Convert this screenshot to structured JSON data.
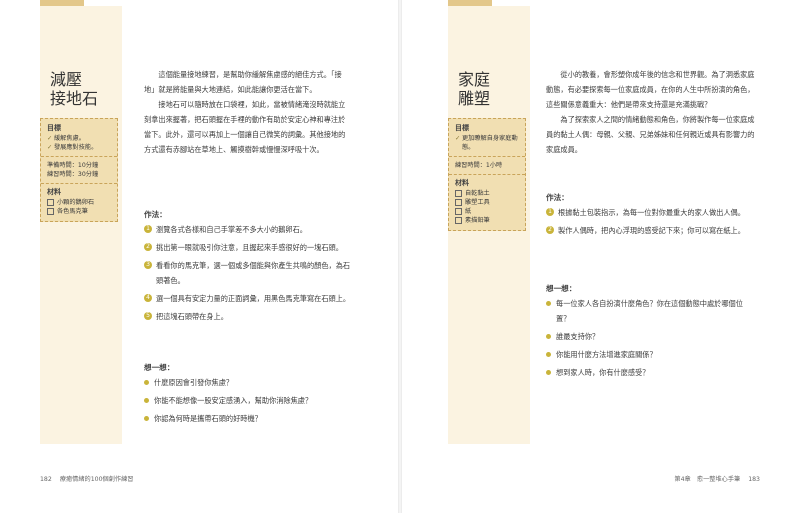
{
  "left": {
    "title": "減壓\n接地石",
    "infobox": {
      "goal_heading": "目標",
      "goals": [
        "緩解焦慮。",
        "發展應對技能。"
      ],
      "prep_time": "準備時間：10分鐘",
      "practice_time": "練習時間：30分鐘",
      "materials_heading": "材料",
      "materials": [
        "小顆的鵝卵石",
        "各色馬克筆"
      ]
    },
    "intro": [
      "這個能量接地練習，是幫助你緩解焦慮感的絕佳方式。「接地」就是將能量與大地連結，如此能讓你更活在當下。",
      "接地石可以隨時放在口袋裡，如此，當被情緒淹沒時就能立刻拿出來握著，把石頭握在手裡的動作有助於安定心神和專注於當下。此外，還可以再加上一個讓自己微笑的詞彙。其他接地的方式還有赤腳站在草地上、觸摸樹幹或慢慢深呼吸十次。"
    ],
    "how_heading": "作法：",
    "steps": [
      "瀏覽各式各樣和自己手掌差不多大小的鵝卵石。",
      "挑出第一眼就吸引你注意，且握起來手感很好的一塊石頭。",
      "看看你的馬克筆，選一個或多個能與你產生共鳴的顏色，為石頭著色。",
      "選一個具有安定力量的正面詞彙，用黑色馬克筆寫在石頭上。",
      "把這塊石頭帶在身上。"
    ],
    "think_heading": "想一想：",
    "questions": [
      "什麼原因會引發你焦慮？",
      "你能不能想像一股安定感湧入，幫助你消除焦慮？",
      "你認為何時是攜帶石頭的好時機？"
    ],
    "page_number": "182",
    "running_title": "療癒情緒的100個創作練習"
  },
  "right": {
    "title": "家庭\n雕塑",
    "infobox": {
      "goal_heading": "目標",
      "goals": [
        "更加瞭解自身家庭動態。"
      ],
      "practice_time": "練習時間：1小時",
      "materials_heading": "材料",
      "materials": [
        "自乾黏土",
        "雕塑工具",
        "紙",
        "素描鉛筆"
      ]
    },
    "intro": [
      "從小的教養，會形塑你成年後的信念和世界觀。為了洞悉家庭動態，有必要探索每一位家庭成員，在你的人生中所扮演的角色，這些關係意義重大：他們是帶來支持還是充滿挑戰？",
      "為了探索家人之間的情緒動態和角色，你將製作每一位家庭成員的黏土人偶：母親、父親、兄弟姊妹和任何親近或具有影響力的家庭成員。"
    ],
    "how_heading": "作法：",
    "steps": [
      "根據黏土包裝指示，為每一位對你最重大的家人做出人偶。",
      "製作人偶時，把內心浮現的感受記下來；你可以寫在紙上。"
    ],
    "think_heading": "想一想：",
    "questions": [
      "每一位家人各自扮演什麼角色？你在這個動態中處於哪個位置？",
      "誰最支持你？",
      "你能用什麼方法增進家庭關係？",
      "想到家人時，你有什麼感受？"
    ],
    "chapter": "第4章　愈一整堆心手筆",
    "page_number": "183"
  }
}
